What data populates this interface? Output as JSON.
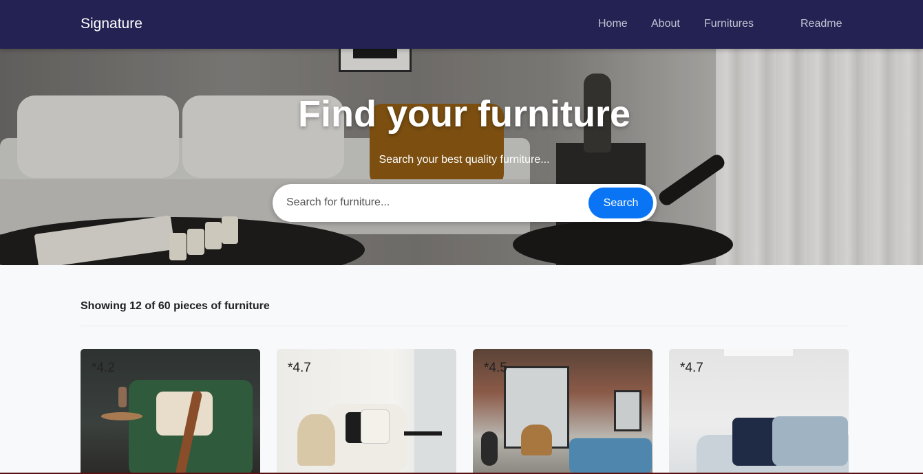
{
  "navbar": {
    "brand": "Signature",
    "links": [
      {
        "label": "Home"
      },
      {
        "label": "About"
      },
      {
        "label": "Furnitures"
      },
      {
        "label": "Readme"
      }
    ]
  },
  "hero": {
    "title": "Find your furniture",
    "subtitle": "Search your best quality furniture...",
    "search": {
      "placeholder": "Search for furniture...",
      "value": "",
      "button_label": "Search"
    }
  },
  "results": {
    "summary": "Showing 12 of 60 pieces of furniture"
  },
  "cards": [
    {
      "rating": "*4.2"
    },
    {
      "rating": "*4.7"
    },
    {
      "rating": "*4.5"
    },
    {
      "rating": "*4.7"
    }
  ],
  "colors": {
    "navbar_bg": "#232253",
    "accent": "#0a75f4",
    "page_bg": "#f8f9fb"
  }
}
